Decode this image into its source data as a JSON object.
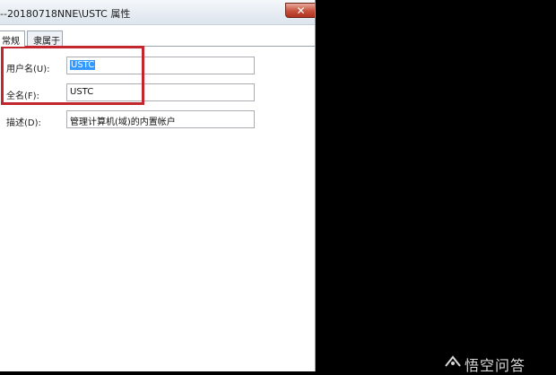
{
  "window": {
    "title": "--20180718NNE\\USTC 属性",
    "close_glyph": "✕"
  },
  "tabs": [
    {
      "label": "常规",
      "active": true
    },
    {
      "label": "隶属于",
      "active": false
    }
  ],
  "fields": {
    "username": {
      "label": "用户名(U):",
      "value": "USTC"
    },
    "fullname": {
      "label": "全名(F):",
      "value": "USTC"
    },
    "description": {
      "label": "描述(D):",
      "value": "管理计算机(域)的内置帐户"
    }
  },
  "watermark": {
    "text": "悟空问答"
  },
  "colors": {
    "highlight": "#c4262e",
    "selection": "#3399ff",
    "background": "#000000"
  }
}
